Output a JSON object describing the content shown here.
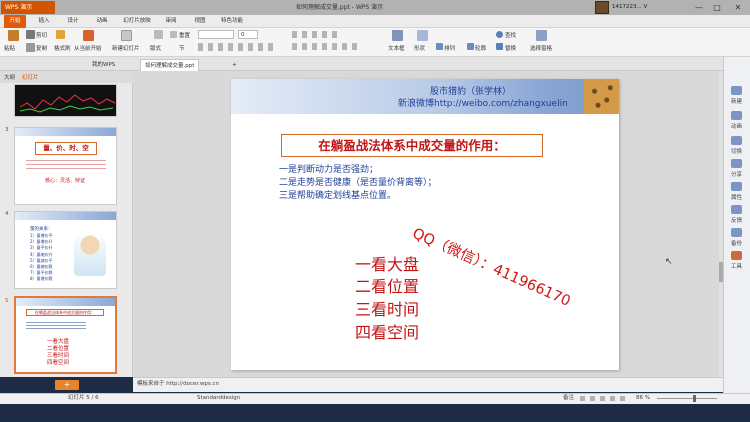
{
  "titlebar": {
    "app_label": "WPS 演示",
    "doc_title": "如何理解成交量.ppt - WPS 演示",
    "user_id": "1417223... V",
    "min_glyph": "—",
    "max_glyph": "□",
    "close_glyph": "✕"
  },
  "menu": [
    "开始",
    "插入",
    "设计",
    "动画",
    "幻灯片放映",
    "审阅",
    "视图",
    "特色功能"
  ],
  "ribbon": {
    "paste": "粘贴",
    "cut": "剪切",
    "copy": "复制",
    "format_painter": "格式刷",
    "from_current": "从当前开始",
    "new_slide": "新建幻灯片",
    "layout": "版式",
    "section": "节",
    "reset": "重置",
    "font_size_value": "0",
    "textbox": "文本框",
    "shape": "形状",
    "arrange": "排列",
    "outline": "轮廓",
    "find": "查找",
    "replace": "替换",
    "select_pane": "选择窗格"
  },
  "tabs": {
    "wps_home": "我的WPS",
    "doc": "如何理解成交量.ppt",
    "add": "+"
  },
  "panel": {
    "tab_outline": "大纲",
    "tab_slides": "幻灯片",
    "thumbs": [
      {
        "num": "3",
        "title": "量、价、时、空",
        "sub": "核心：灵活、辩证"
      },
      {
        "num": "4",
        "title": "量的关系：",
        "lines": [
          "1）量增价平",
          "2）量增价升",
          "3）量平价升",
          "4）量缩价升",
          "5）量减价平",
          "6）量缩价跌",
          "7）量平价跌",
          "8）量增价跌"
        ]
      },
      {
        "num": "5",
        "title": "在躺盈战法体系中成交量的作用：",
        "lines": [
          "一看大盘",
          "二看位置",
          "三看时间",
          "四看空间"
        ]
      }
    ],
    "add_button": "+"
  },
  "slide": {
    "banner_line1": "股市猎豹（张学林）",
    "banner_line2": "新浪微博http://weibo.com/zhangxuelin",
    "title": "在躺盈战法体系中成交量的作用：",
    "points": [
      "一是判断动力是否强劲；",
      "二是走势是否健康（是否量价背离等）；",
      "三是帮助确定划线基点位置。"
    ],
    "big_lines": [
      "一看大盘",
      "二看位置",
      "三看时间",
      "四看空间"
    ],
    "watermark": "QQ（微信）：411966170"
  },
  "notes": "模板来自于 http://docer.wps.cn",
  "sidebar": [
    "新建",
    "动画",
    "切换",
    "分享",
    "属性",
    "反馈",
    "备份",
    "工具"
  ],
  "status": {
    "slide_counter": "幻灯片 5 / 6",
    "theme": "Standarddesign",
    "notes_toggle": "备注",
    "zoom": "86 %"
  },
  "colors": {
    "accent": "#e05a0c",
    "slide_red": "#c41414",
    "slide_blue": "#1f3f9a"
  }
}
